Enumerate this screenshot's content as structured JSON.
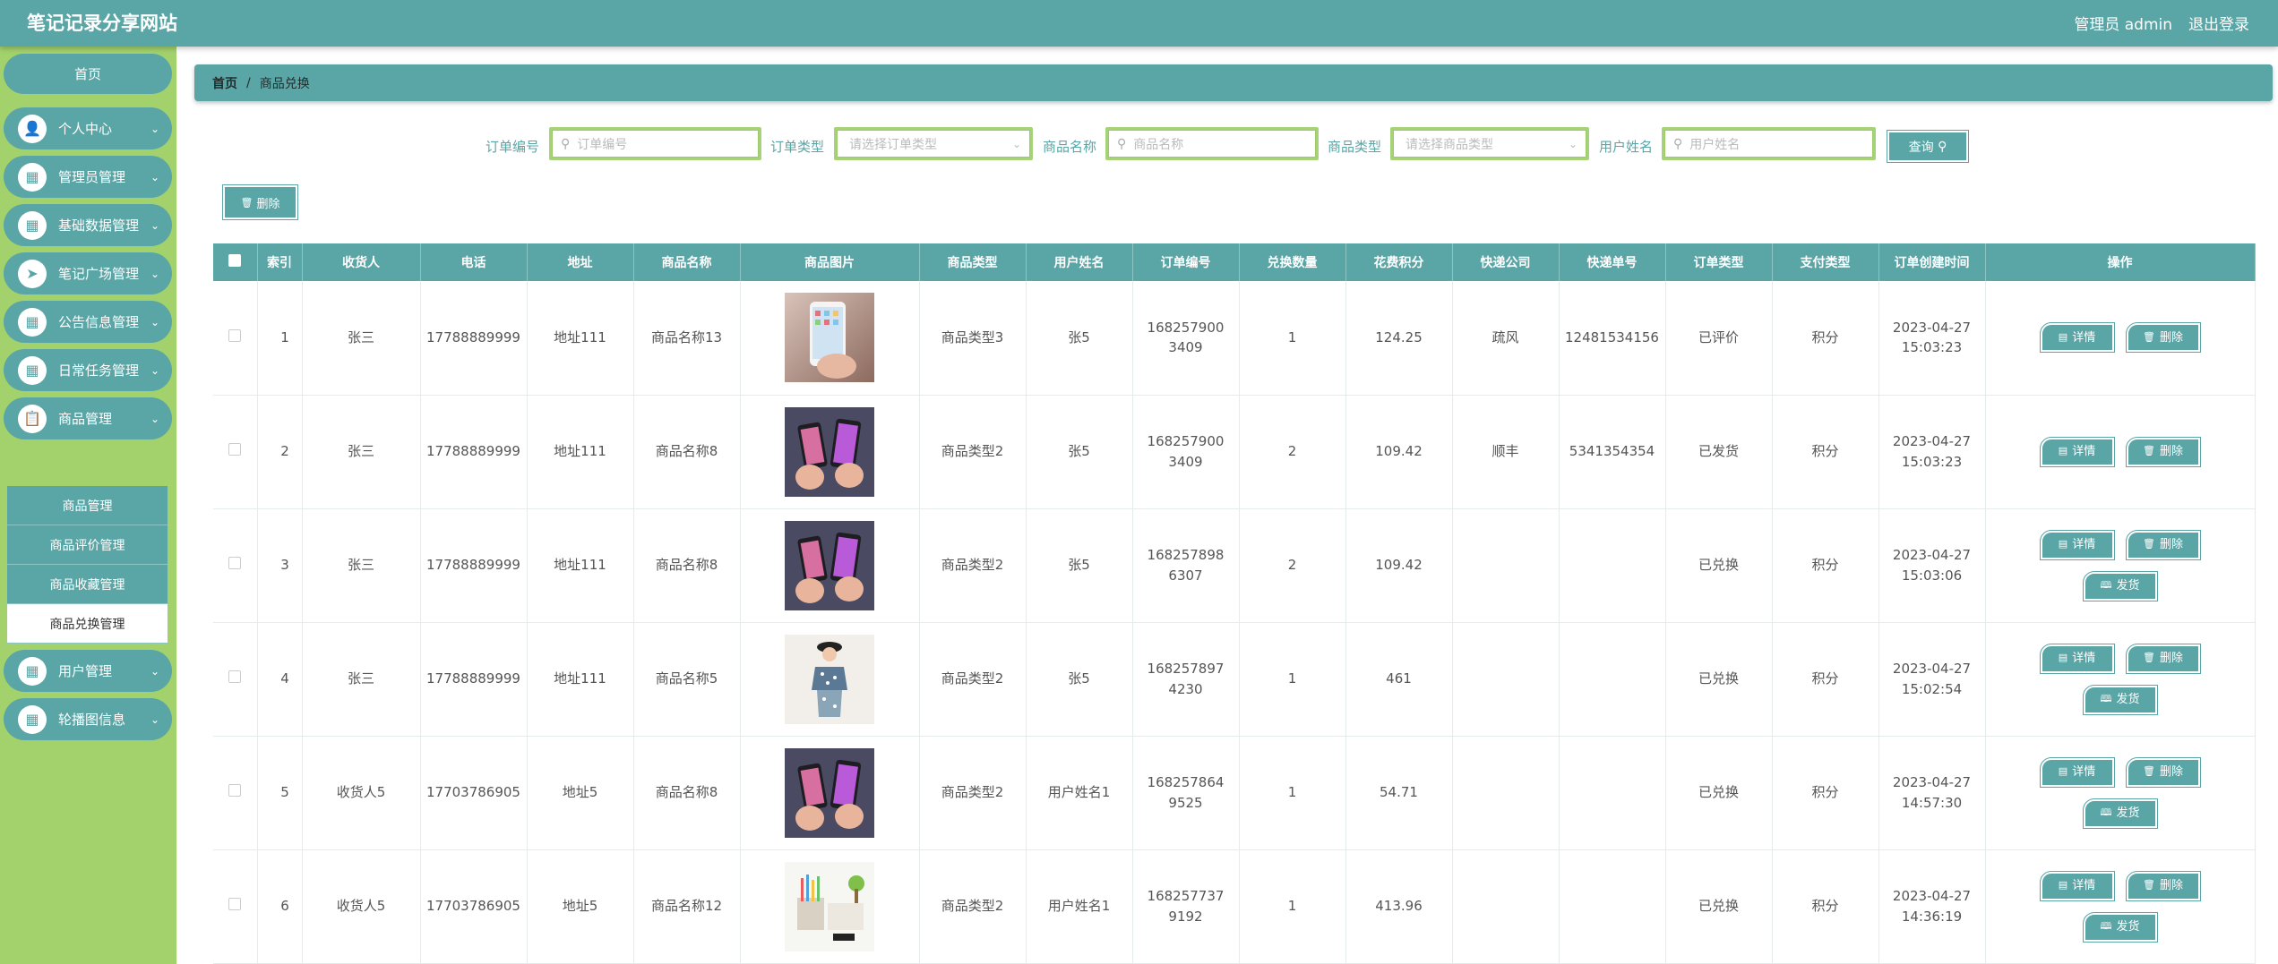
{
  "header": {
    "site_title": "笔记记录分享网站",
    "admin_label": "管理员 admin",
    "logout_label": "退出登录"
  },
  "sidebar": {
    "home": "首页",
    "items": [
      {
        "label": "个人中心",
        "icon": "person-icon"
      },
      {
        "label": "管理员管理",
        "icon": "grid-icon"
      },
      {
        "label": "基础数据管理",
        "icon": "grid-icon"
      },
      {
        "label": "笔记广场管理",
        "icon": "send-icon"
      },
      {
        "label": "公告信息管理",
        "icon": "grid-icon"
      },
      {
        "label": "日常任务管理",
        "icon": "grid-icon"
      },
      {
        "label": "商品管理",
        "icon": "clipboard-icon"
      },
      {
        "label": "用户管理",
        "icon": "grid-icon"
      },
      {
        "label": "轮播图信息",
        "icon": "grid-icon"
      }
    ],
    "sub_items": [
      "商品管理",
      "商品评价管理",
      "商品收藏管理",
      "商品兑换管理"
    ]
  },
  "breadcrumb": {
    "home": "首页",
    "separator": "/",
    "current": "商品兑换"
  },
  "search": {
    "order_no_label": "订单编号",
    "order_no_placeholder": "订单编号",
    "order_type_label": "订单类型",
    "order_type_placeholder": "请选择订单类型",
    "goods_name_label": "商品名称",
    "goods_name_placeholder": "商品名称",
    "goods_type_label": "商品类型",
    "goods_type_placeholder": "请选择商品类型",
    "user_name_label": "用户姓名",
    "user_name_placeholder": "用户姓名",
    "query_label": "查询"
  },
  "toolbar": {
    "delete_label": "删除"
  },
  "table": {
    "headers": [
      "索引",
      "收货人",
      "电话",
      "地址",
      "商品名称",
      "商品图片",
      "商品类型",
      "用户姓名",
      "订单编号",
      "兑换数量",
      "花费积分",
      "快递公司",
      "快递单号",
      "订单类型",
      "支付类型",
      "订单创建时间",
      "操作"
    ],
    "detail_label": "详情",
    "delete_label": "删除",
    "ship_label": "发货",
    "rows": [
      {
        "idx": "1",
        "receiver": "张三",
        "phone": "17788889999",
        "address": "地址111",
        "goods": "商品名称13",
        "image": "phone-single",
        "type": "商品类型3",
        "user": "张5",
        "order_no": "1682579003409",
        "qty": "1",
        "points": "124.25",
        "express": "疏风",
        "express_no": "12481534156",
        "order_type": "已评价",
        "pay_type": "积分",
        "created": "2023-04-27 15:03:23",
        "ship": false
      },
      {
        "idx": "2",
        "receiver": "张三",
        "phone": "17788889999",
        "address": "地址111",
        "goods": "商品名称8",
        "image": "phone-pair",
        "type": "商品类型2",
        "user": "张5",
        "order_no": "1682579003409",
        "qty": "2",
        "points": "109.42",
        "express": "顺丰",
        "express_no": "5341354354",
        "order_type": "已发货",
        "pay_type": "积分",
        "created": "2023-04-27 15:03:23",
        "ship": false
      },
      {
        "idx": "3",
        "receiver": "张三",
        "phone": "17788889999",
        "address": "地址111",
        "goods": "商品名称8",
        "image": "phone-pair",
        "type": "商品类型2",
        "user": "张5",
        "order_no": "1682578986307",
        "qty": "2",
        "points": "109.42",
        "express": "",
        "express_no": "",
        "order_type": "已兑换",
        "pay_type": "积分",
        "created": "2023-04-27 15:03:06",
        "ship": true
      },
      {
        "idx": "4",
        "receiver": "张三",
        "phone": "17788889999",
        "address": "地址111",
        "goods": "商品名称5",
        "image": "clothing",
        "type": "商品类型2",
        "user": "张5",
        "order_no": "1682578974230",
        "qty": "1",
        "points": "461",
        "express": "",
        "express_no": "",
        "order_type": "已兑换",
        "pay_type": "积分",
        "created": "2023-04-27 15:02:54",
        "ship": true
      },
      {
        "idx": "5",
        "receiver": "收货人5",
        "phone": "17703786905",
        "address": "地址5",
        "goods": "商品名称8",
        "image": "phone-pair",
        "type": "商品类型2",
        "user": "用户姓名1",
        "order_no": "1682578649525",
        "qty": "1",
        "points": "54.71",
        "express": "",
        "express_no": "",
        "order_type": "已兑换",
        "pay_type": "积分",
        "created": "2023-04-27 14:57:30",
        "ship": true
      },
      {
        "idx": "6",
        "receiver": "收货人5",
        "phone": "17703786905",
        "address": "地址5",
        "goods": "商品名称12",
        "image": "stationery",
        "type": "商品类型2",
        "user": "用户姓名1",
        "order_no": "1682577379192",
        "qty": "1",
        "points": "413.96",
        "express": "",
        "express_no": "",
        "order_type": "已兑换",
        "pay_type": "积分",
        "created": "2023-04-27 14:36:19",
        "ship": true
      }
    ]
  },
  "colors": {
    "primary": "#5aa5a6",
    "sidebar_bg": "#a3d26c",
    "input_border": "#a7d378"
  }
}
